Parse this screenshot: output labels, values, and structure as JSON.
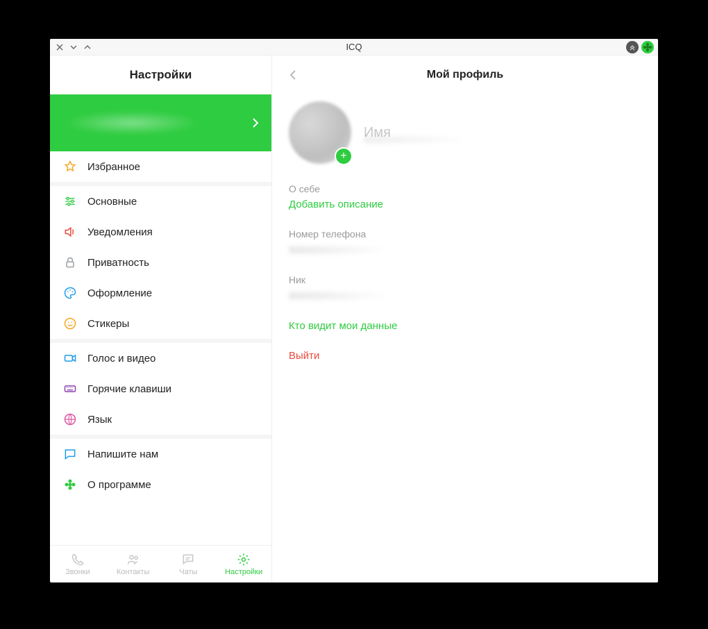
{
  "titlebar": {
    "title": "ICQ"
  },
  "sidebar": {
    "header": "Настройки",
    "groups": [
      [
        {
          "id": "favorites",
          "label": "Избранное",
          "color": "#f5a623",
          "icon": "star"
        }
      ],
      [
        {
          "id": "general",
          "label": "Основные",
          "color": "#2ecc40",
          "icon": "sliders"
        },
        {
          "id": "notify",
          "label": "Уведомления",
          "color": "#e74c3c",
          "icon": "speaker"
        },
        {
          "id": "privacy",
          "label": "Приватность",
          "color": "#9aa0a6",
          "icon": "lock"
        },
        {
          "id": "theme",
          "label": "Оформление",
          "color": "#1e9ee8",
          "icon": "palette"
        },
        {
          "id": "stickers",
          "label": "Стикеры",
          "color": "#f5a623",
          "icon": "smile"
        }
      ],
      [
        {
          "id": "voice",
          "label": "Голос и видео",
          "color": "#1e9ee8",
          "icon": "camera"
        },
        {
          "id": "hotkeys",
          "label": "Горячие клавиши",
          "color": "#8e44ad",
          "icon": "keyboard"
        },
        {
          "id": "language",
          "label": "Язык",
          "color": "#e056a0",
          "icon": "globe"
        }
      ],
      [
        {
          "id": "feedback",
          "label": "Напишите нам",
          "color": "#1e9ee8",
          "icon": "chat"
        },
        {
          "id": "about",
          "label": "О программе",
          "color": "#2ecc40",
          "icon": "flower"
        }
      ]
    ]
  },
  "nav": {
    "items": [
      {
        "id": "calls",
        "label": "Звонки",
        "icon": "phone",
        "active": false
      },
      {
        "id": "contacts",
        "label": "Контакты",
        "icon": "contacts",
        "active": false
      },
      {
        "id": "chats",
        "label": "Чаты",
        "icon": "chats",
        "active": false
      },
      {
        "id": "settings",
        "label": "Настройки",
        "icon": "gear",
        "active": true
      }
    ]
  },
  "profile": {
    "title": "Мой профиль",
    "name_placeholder": "Имя",
    "about_label": "О себе",
    "about_action": "Добавить описание",
    "phone_label": "Номер телефона",
    "nick_label": "Ник",
    "privacy_link": "Кто видит мои данные",
    "logout": "Выйти"
  }
}
